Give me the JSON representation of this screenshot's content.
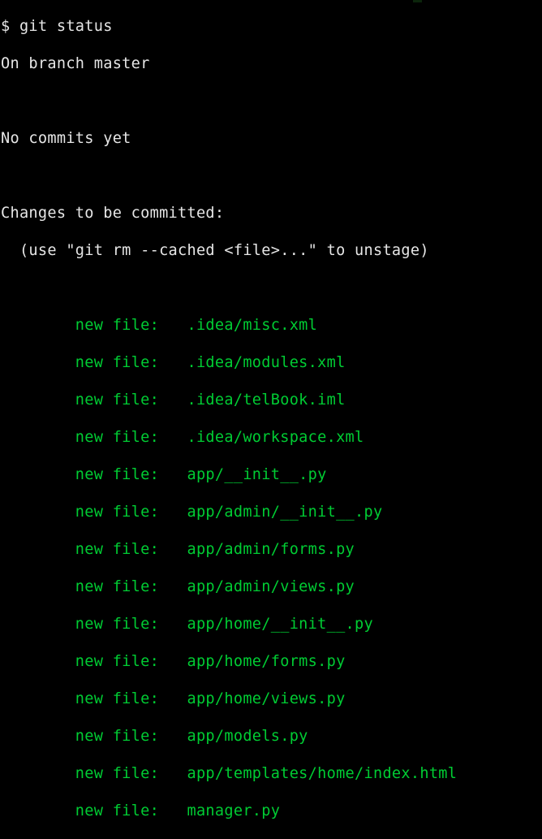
{
  "terminal": {
    "colors": {
      "background": "#000000",
      "output_text": "#e6e6e6",
      "staged_file": "#00cc33"
    },
    "prompt_symbol": "$",
    "command": "git status",
    "lines": [
      {
        "kind": "command",
        "text": "$ git status"
      },
      {
        "kind": "output",
        "text": "On branch master"
      },
      {
        "kind": "blank",
        "text": ""
      },
      {
        "kind": "output",
        "text": "No commits yet"
      },
      {
        "kind": "blank",
        "text": ""
      },
      {
        "kind": "output",
        "text": "Changes to be committed:"
      },
      {
        "kind": "output",
        "text": "  (use \"git rm --cached <file>...\" to unstage)"
      },
      {
        "kind": "blank",
        "text": ""
      },
      {
        "kind": "staged",
        "text": "        new file:   .idea/misc.xml"
      },
      {
        "kind": "staged",
        "text": "        new file:   .idea/modules.xml"
      },
      {
        "kind": "staged",
        "text": "        new file:   .idea/telBook.iml"
      },
      {
        "kind": "staged",
        "text": "        new file:   .idea/workspace.xml"
      },
      {
        "kind": "staged",
        "text": "        new file:   app/__init__.py"
      },
      {
        "kind": "staged",
        "text": "        new file:   app/admin/__init__.py"
      },
      {
        "kind": "staged",
        "text": "        new file:   app/admin/forms.py"
      },
      {
        "kind": "staged",
        "text": "        new file:   app/admin/views.py"
      },
      {
        "kind": "staged",
        "text": "        new file:   app/home/__init__.py"
      },
      {
        "kind": "staged",
        "text": "        new file:   app/home/forms.py"
      },
      {
        "kind": "staged",
        "text": "        new file:   app/home/views.py"
      },
      {
        "kind": "staged",
        "text": "        new file:   app/models.py"
      },
      {
        "kind": "staged",
        "text": "        new file:   app/templates/home/index.html"
      },
      {
        "kind": "staged",
        "text": "        new file:   manager.py"
      }
    ],
    "branch": "master",
    "commit_state": "No commits yet",
    "section_heading": "Changes to be committed:",
    "section_hint": "(use \"git rm --cached <file>...\" to unstage)",
    "staged_change_type": "new file:",
    "staged_files": [
      ".idea/misc.xml",
      ".idea/modules.xml",
      ".idea/telBook.iml",
      ".idea/workspace.xml",
      "app/__init__.py",
      "app/admin/__init__.py",
      "app/admin/forms.py",
      "app/admin/views.py",
      "app/home/__init__.py",
      "app/home/forms.py",
      "app/home/views.py",
      "app/models.py",
      "app/templates/home/index.html",
      "manager.py"
    ]
  }
}
